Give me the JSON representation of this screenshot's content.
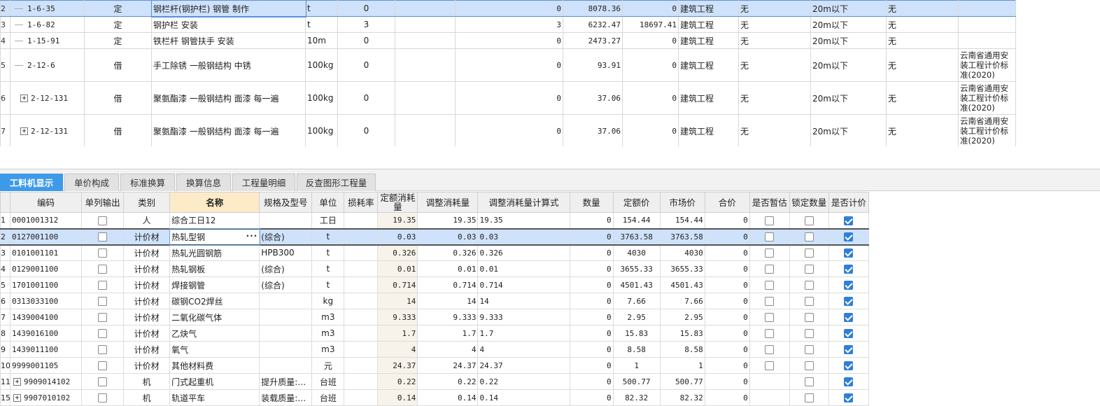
{
  "top_rows": [
    {
      "rn": "2",
      "code": "1-6-35",
      "tree": "line",
      "type": "定",
      "name": "钢栏杆(钢护栏) 钢管 制作",
      "unit": "t",
      "qty": "0",
      "c6": "",
      "c7": "0",
      "price": "8078.36",
      "total": "0",
      "cat": "建筑工程",
      "c11": "无",
      "c12": "20m以下",
      "c13": "无",
      "c14": "",
      "selected": true,
      "tall": false
    },
    {
      "rn": "3",
      "code": "1-6-82",
      "tree": "line",
      "type": "定",
      "name": "钢护栏 安装",
      "unit": "t",
      "qty": "3",
      "c6": "",
      "c7": "3",
      "price": "6232.47",
      "total": "18697.41",
      "cat": "建筑工程",
      "c11": "无",
      "c12": "20m以下",
      "c13": "无",
      "c14": "",
      "selected": false,
      "tall": false
    },
    {
      "rn": "4",
      "code": "1-15-91",
      "tree": "line",
      "type": "定",
      "name": "铁栏杆 钢管扶手 安装",
      "unit": "10m",
      "qty": "0",
      "c6": "",
      "c7": "0",
      "price": "2473.27",
      "total": "0",
      "cat": "建筑工程",
      "c11": "无",
      "c12": "20m以下",
      "c13": "无",
      "c14": "",
      "selected": false,
      "tall": false
    },
    {
      "rn": "5",
      "code": "2-12-6",
      "tree": "line",
      "type": "借",
      "name": "手工除锈 一般钢结构 中锈",
      "unit": "100kg",
      "qty": "0",
      "c6": "",
      "c7": "0",
      "price": "93.91",
      "total": "0",
      "cat": "建筑工程",
      "c11": "无",
      "c12": "20m以下",
      "c13": "无",
      "c14": "云南省通用安装工程计价标准(2020)",
      "selected": false,
      "tall": true
    },
    {
      "rn": "6",
      "code": "2-12-131",
      "tree": "plus",
      "type": "借",
      "name": "聚氨酯漆 一般钢结构 面漆 每一遍",
      "unit": "100kg",
      "qty": "0",
      "c6": "",
      "c7": "0",
      "price": "37.06",
      "total": "0",
      "cat": "建筑工程",
      "c11": "无",
      "c12": "20m以下",
      "c13": "无",
      "c14": "云南省通用安装工程计价标准(2020)",
      "selected": false,
      "tall": true
    },
    {
      "rn": "7",
      "code": "2-12-131",
      "tree": "plus",
      "type": "借",
      "name": "聚氨酯漆 一般钢结构 面漆 每一遍",
      "unit": "100kg",
      "qty": "0",
      "c6": "",
      "c7": "0",
      "price": "37.06",
      "total": "0",
      "cat": "建筑工程",
      "c11": "无",
      "c12": "20m以下",
      "c13": "无",
      "c14": "云南省通用安装工程计价标准(2020)",
      "selected": false,
      "tall": true
    }
  ],
  "tabs": [
    {
      "label": "工料机显示",
      "active": true
    },
    {
      "label": "单价构成",
      "active": false
    },
    {
      "label": "标准换算",
      "active": false
    },
    {
      "label": "换算信息",
      "active": false
    },
    {
      "label": "工程量明细",
      "active": false
    },
    {
      "label": "反查图形工程量",
      "active": false
    }
  ],
  "headers": [
    "",
    "编码",
    "单列输出",
    "类别",
    "名称",
    "规格及型号",
    "单位",
    "损耗率",
    "定额消耗量",
    "调整消耗量",
    "调整消耗量计算式",
    "数量",
    "定额价",
    "市场价",
    "合价",
    "是否暂估",
    "锁定数量",
    "是否计价"
  ],
  "bottom_rows": [
    {
      "rn": "1",
      "code": "0001001312",
      "plus": false,
      "cat": "人",
      "name": "综合工日12",
      "spec": "",
      "unit": "工日",
      "loss": "",
      "quota": "19.35",
      "adj": "19.35",
      "formula": "19.35",
      "qty": "0",
      "qprice": "154.44",
      "mprice": "154.44",
      "total": "0",
      "est": false,
      "lock": false,
      "priced": true
    },
    {
      "rn": "2",
      "code": "0127001100",
      "plus": false,
      "cat": "计价材",
      "name": "热轧型钢",
      "spec": "(综合)",
      "unit": "t",
      "loss": "",
      "quota": "0.03",
      "adj": "0.03",
      "formula": "0.03",
      "qty": "0",
      "qprice": "3763.58",
      "mprice": "3763.58",
      "total": "0",
      "est": false,
      "lock": false,
      "priced": true,
      "selected": true
    },
    {
      "rn": "3",
      "code": "0101001101",
      "plus": false,
      "cat": "计价材",
      "name": "热轧光圆钢筋",
      "spec": "HPB300",
      "unit": "t",
      "loss": "",
      "quota": "0.326",
      "adj": "0.326",
      "formula": "0.326",
      "qty": "0",
      "qprice": "4030",
      "mprice": "4030",
      "total": "0",
      "est": false,
      "lock": false,
      "priced": true
    },
    {
      "rn": "4",
      "code": "0129001100",
      "plus": false,
      "cat": "计价材",
      "name": "热轧钢板",
      "spec": "(综合)",
      "unit": "t",
      "loss": "",
      "quota": "0.01",
      "adj": "0.01",
      "formula": "0.01",
      "qty": "0",
      "qprice": "3655.33",
      "mprice": "3655.33",
      "total": "0",
      "est": false,
      "lock": false,
      "priced": true
    },
    {
      "rn": "5",
      "code": "1701001100",
      "plus": false,
      "cat": "计价材",
      "name": "焊接钢管",
      "spec": "(综合)",
      "unit": "t",
      "loss": "",
      "quota": "0.714",
      "adj": "0.714",
      "formula": "0.714",
      "qty": "0",
      "qprice": "4501.43",
      "mprice": "4501.43",
      "total": "0",
      "est": false,
      "lock": false,
      "priced": true
    },
    {
      "rn": "6",
      "code": "0313033100",
      "plus": false,
      "cat": "计价材",
      "name": "碳钢CO2焊丝",
      "spec": "",
      "unit": "kg",
      "loss": "",
      "quota": "14",
      "adj": "14",
      "formula": "14",
      "qty": "0",
      "qprice": "7.66",
      "mprice": "7.66",
      "total": "0",
      "est": false,
      "lock": false,
      "priced": true
    },
    {
      "rn": "7",
      "code": "1439004100",
      "plus": false,
      "cat": "计价材",
      "name": "二氧化碳气体",
      "spec": "",
      "unit": "m3",
      "loss": "",
      "quota": "9.333",
      "adj": "9.333",
      "formula": "9.333",
      "qty": "0",
      "qprice": "2.95",
      "mprice": "2.95",
      "total": "0",
      "est": false,
      "lock": false,
      "priced": true
    },
    {
      "rn": "8",
      "code": "1439016100",
      "plus": false,
      "cat": "计价材",
      "name": "乙炔气",
      "spec": "",
      "unit": "m3",
      "loss": "",
      "quota": "1.7",
      "adj": "1.7",
      "formula": "1.7",
      "qty": "0",
      "qprice": "15.83",
      "mprice": "15.83",
      "total": "0",
      "est": false,
      "lock": false,
      "priced": true
    },
    {
      "rn": "9",
      "code": "1439011100",
      "plus": false,
      "cat": "计价材",
      "name": "氧气",
      "spec": "",
      "unit": "m3",
      "loss": "",
      "quota": "4",
      "adj": "4",
      "formula": "4",
      "qty": "0",
      "qprice": "8.58",
      "mprice": "8.58",
      "total": "0",
      "est": false,
      "lock": false,
      "priced": true
    },
    {
      "rn": "10",
      "code": "9999001105",
      "plus": false,
      "cat": "计价材",
      "name": "其他材料费",
      "spec": "",
      "unit": "元",
      "loss": "",
      "quota": "24.37",
      "adj": "24.37",
      "formula": "24.37",
      "qty": "0",
      "qprice": "1",
      "mprice": "1",
      "total": "0",
      "est": false,
      "lock": false,
      "priced": true
    },
    {
      "rn": "11",
      "code": "9909014102",
      "plus": true,
      "cat": "机",
      "name": "门式起重机",
      "spec": "提升质量:…",
      "unit": "台班",
      "loss": "",
      "quota": "0.22",
      "adj": "0.22",
      "formula": "0.22",
      "qty": "0",
      "qprice": "500.77",
      "mprice": "500.77",
      "total": "0",
      "est": null,
      "lock": false,
      "priced": true
    },
    {
      "rn": "15",
      "code": "9907010102",
      "plus": true,
      "cat": "机",
      "name": "轨道平车",
      "spec": "装载质量:…",
      "unit": "台班",
      "loss": "",
      "quota": "0.14",
      "adj": "0.14",
      "formula": "0.14",
      "qty": "0",
      "qprice": "82.32",
      "mprice": "82.32",
      "total": "0",
      "est": null,
      "lock": false,
      "priced": true
    }
  ],
  "name_cell_ellipsis": "···"
}
